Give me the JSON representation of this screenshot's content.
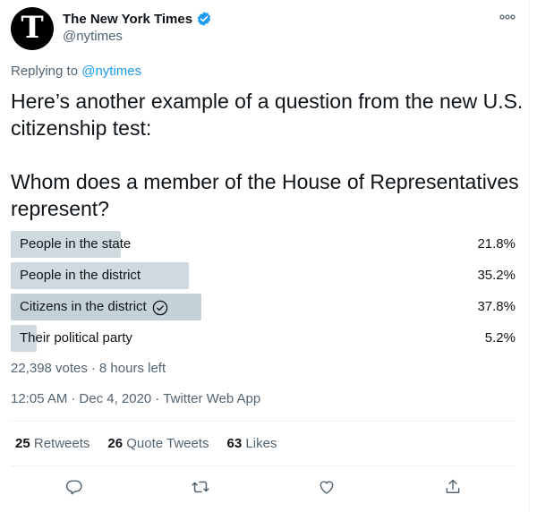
{
  "author": {
    "display_name": "The New York Times",
    "handle": "@nytimes",
    "verified": true,
    "avatar_glyph": "T"
  },
  "reply": {
    "prefix": "Replying to",
    "mention": "@nytimes"
  },
  "tweet_text": "Here’s another example of a question from the new U.S. citizenship test:\n\nWhom does a member of the House of Representatives represent?",
  "poll": {
    "options": [
      {
        "label": "People in the state",
        "percent": "21.8%",
        "fraction": 0.218,
        "winner": false
      },
      {
        "label": "People in the district",
        "percent": "35.2%",
        "fraction": 0.352,
        "winner": false
      },
      {
        "label": "Citizens in the district",
        "percent": "37.8%",
        "fraction": 0.378,
        "winner": true
      },
      {
        "label": "Their political party",
        "percent": "5.2%",
        "fraction": 0.052,
        "winner": false
      }
    ],
    "votes": "22,398 votes",
    "time_left": "8 hours left"
  },
  "timestamp": {
    "time": "12:05 AM",
    "date": "Dec 4, 2020",
    "source": "Twitter Web App"
  },
  "stats": {
    "retweets_count": "25",
    "retweets_label": "Retweets",
    "quotes_count": "26",
    "quotes_label": "Quote Tweets",
    "likes_count": "63",
    "likes_label": "Likes"
  },
  "colors": {
    "accent": "#1d9bf0",
    "poll_bar": "#cfd9de",
    "secondary_text": "#536471"
  },
  "icons": [
    "verified-badge-icon",
    "more-options-icon",
    "check-circle-icon",
    "reply-icon",
    "retweet-icon",
    "like-icon",
    "share-icon"
  ]
}
